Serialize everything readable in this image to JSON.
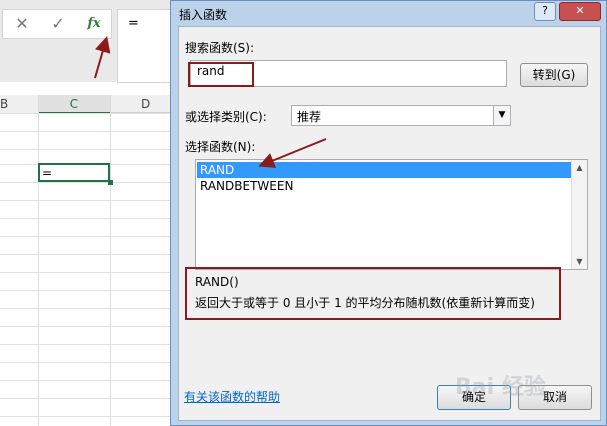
{
  "formula_bar": {
    "cancel_glyph": "✕",
    "enter_glyph": "✓",
    "fx_label": "fx",
    "content": "="
  },
  "sheet": {
    "columns": [
      "B",
      "C",
      "D"
    ],
    "selected_column": "C",
    "active_cell_value": "="
  },
  "dialog": {
    "title": "插入函数",
    "help_button": "?",
    "close_button": "✕",
    "search_label": "搜索函数(S):",
    "search_value": "rand",
    "goto_button": "转到(G)",
    "category_label": "或选择类别(C):",
    "category_value": "推荐",
    "function_list_label": "选择函数(N):",
    "functions": [
      {
        "name": "RAND",
        "selected": true
      },
      {
        "name": "RANDBETWEEN",
        "selected": false
      }
    ],
    "signature": "RAND()",
    "description": "返回大于或等于 0 且小于 1 的平均分布随机数(依重新计算而变)",
    "help_link": "有关该函数的帮助",
    "ok_button": "确定",
    "cancel_button": "取消"
  },
  "watermark": "Bai 经验",
  "colors": {
    "excel_green": "#217346",
    "selection_blue": "#3399ff",
    "annotation_red": "#8b1a1a",
    "link_blue": "#0066cc"
  }
}
